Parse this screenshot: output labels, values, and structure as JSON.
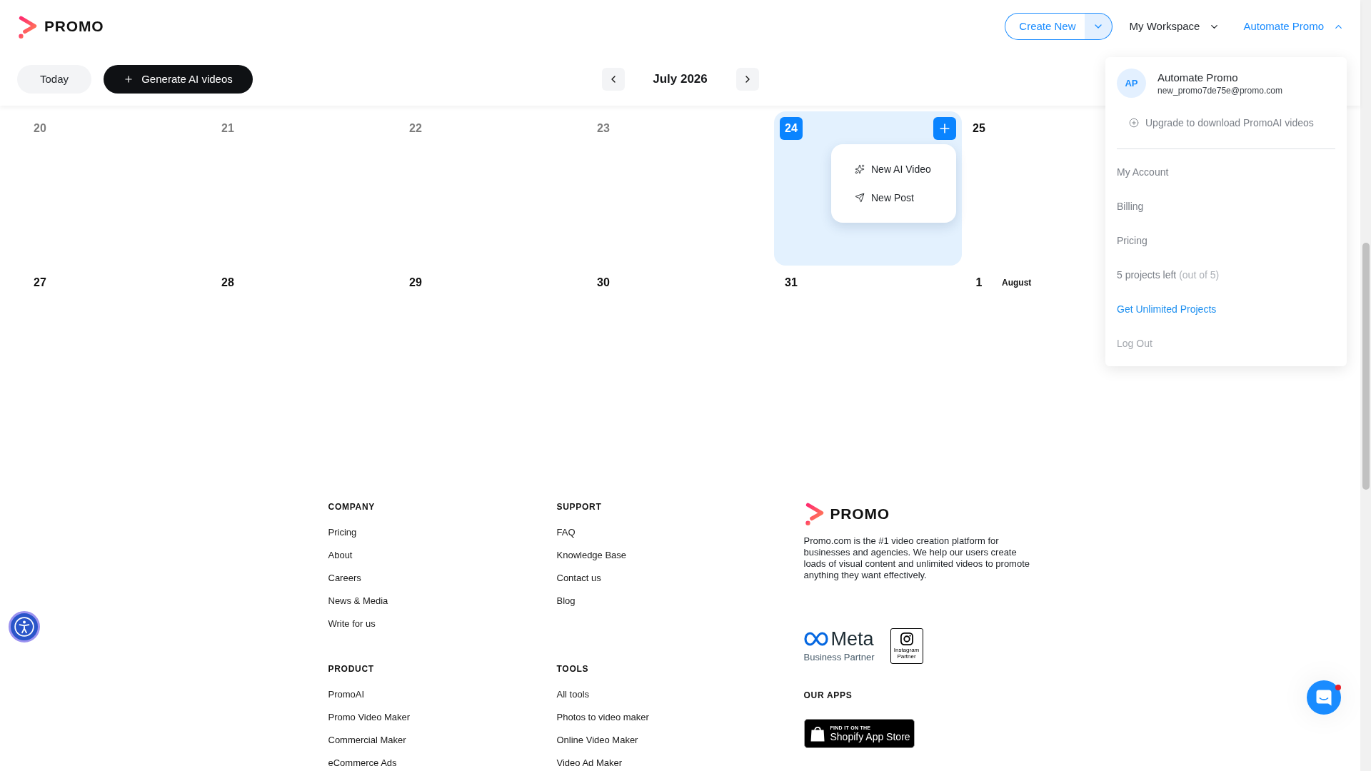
{
  "header": {
    "logo_text": "PROMO",
    "create_button": {
      "label": "Create New"
    },
    "menus": [
      {
        "label": "My Workspace",
        "expanded": false
      },
      {
        "label": "Automate Promo",
        "expanded": true
      }
    ]
  },
  "toolbar": {
    "today_button": "Today",
    "generate_button": "Generate AI videos",
    "month": "July 2026"
  },
  "calendar": {
    "weeks": [
      {
        "days": [
          {
            "number": "20",
            "past": true,
            "selected": false
          },
          {
            "number": "21",
            "past": true,
            "selected": false
          },
          {
            "number": "22",
            "past": true,
            "selected": false
          },
          {
            "number": "23",
            "past": true,
            "selected": false
          },
          {
            "number": "24",
            "past": false,
            "selected": true
          },
          {
            "number": "25",
            "past": false,
            "selected": false
          }
        ]
      },
      {
        "days": [
          {
            "number": "27",
            "past": false,
            "selected": false
          },
          {
            "number": "28",
            "past": false,
            "selected": false
          },
          {
            "number": "29",
            "past": false,
            "selected": false
          },
          {
            "number": "30",
            "past": false,
            "selected": false
          },
          {
            "number": "31",
            "past": false,
            "selected": false
          },
          {
            "number": "1",
            "past": false,
            "selected": false,
            "month_label": "August"
          }
        ]
      }
    ],
    "day_menu": [
      {
        "kind": "ai",
        "label": "New AI Video"
      },
      {
        "kind": "post",
        "label": "New Post"
      }
    ]
  },
  "account_dropdown": {
    "initials": "AP",
    "name": "Automate Promo",
    "email": "new_promo7de75e@promo.com",
    "upgrade_link": "Upgrade to download PromoAI videos",
    "items": [
      {
        "kind": "link",
        "label": "My Account"
      },
      {
        "kind": "link",
        "label": "Billing"
      },
      {
        "kind": "link",
        "label": "Pricing"
      },
      {
        "kind": "quota",
        "label": "5 projects left",
        "note": "(out of 5)"
      },
      {
        "kind": "upgrade",
        "label": "Get Unlimited Projects"
      },
      {
        "kind": "logout",
        "label": "Log Out"
      }
    ]
  },
  "footer": {
    "columns": [
      {
        "title": "COMPANY",
        "links": [
          "Pricing",
          "About",
          "Careers",
          "News & Media",
          "Write for us"
        ]
      },
      {
        "title": "SUPPORT",
        "links": [
          "FAQ",
          "Knowledge Base",
          "Contact us",
          "Blog"
        ]
      },
      {
        "title": "PRODUCT",
        "links": [
          "PromoAI",
          "Promo Video Maker",
          "Commercial Maker",
          "eCommerce Ads"
        ]
      },
      {
        "title": "TOOLS",
        "links": [
          "All tools",
          "Photos to video maker",
          "Online Video Maker",
          "Video Ad Maker"
        ]
      }
    ],
    "brand": {
      "logo_text": "PROMO",
      "description": "Promo.com is the #1 video creation platform for businesses and agencies. We help our users create loads of visual content and unlimited videos to promote anything they want effectively."
    },
    "partners": [
      {
        "kind": "meta",
        "name": "Meta",
        "caption": "Business Partner"
      },
      {
        "kind": "instagram",
        "caption": "Instagram Partner"
      }
    ],
    "apps_title": "OUR APPS",
    "app_badges": [
      {
        "kind": "shopify",
        "small": "FIND IT ON THE",
        "name": "Shopify App Store"
      }
    ]
  },
  "chat_button": {
    "unread": true
  }
}
